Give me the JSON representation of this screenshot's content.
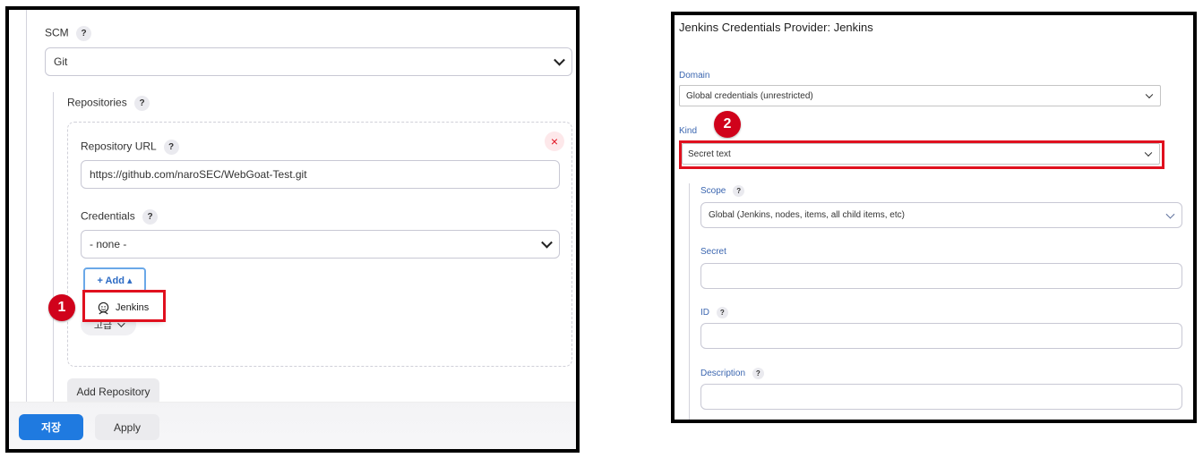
{
  "left": {
    "scm_label": "SCM",
    "help": "?",
    "scm_value": "Git",
    "repositories_label": "Repositories",
    "repo_url_label": "Repository URL",
    "repo_url_value": "https://github.com/naroSEC/WebGoat-Test.git",
    "remove_glyph": "×",
    "credentials_label": "Credentials",
    "credentials_value": "- none -",
    "add_button": "+ Add ▴",
    "dropdown_item": "Jenkins",
    "advanced_button": "고급",
    "add_repository_button": "Add Repository",
    "save_button": "저장",
    "apply_button": "Apply",
    "badge_number": "1"
  },
  "right": {
    "title": "Jenkins Credentials Provider: Jenkins",
    "domain_label": "Domain",
    "domain_value": "Global credentials (unrestricted)",
    "kind_label": "Kind",
    "kind_value": "Secret text",
    "scope_label": "Scope",
    "scope_value": "Global (Jenkins, nodes, items, all child items, etc)",
    "secret_label": "Secret",
    "id_label": "ID",
    "description_label": "Description",
    "help": "?",
    "badge_number": "2"
  },
  "colors": {
    "primary_blue": "#1f7ae0",
    "highlight_red": "#e0101e",
    "badge_red": "#d0021b"
  }
}
